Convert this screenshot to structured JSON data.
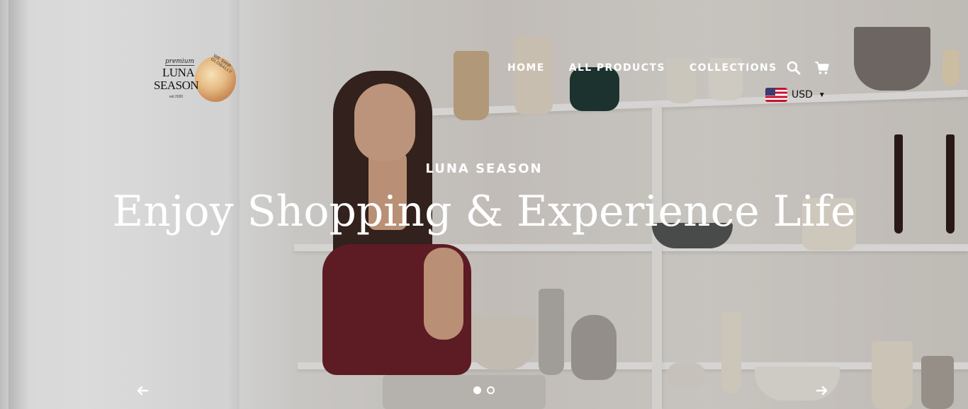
{
  "brand": {
    "logo_top": "premium",
    "logo_line1": "LUNA",
    "logo_line2": "SEASON",
    "logo_est": "est 2020",
    "logo_ribbon": "WE SHIP GLOBALLY"
  },
  "nav": {
    "items": [
      "HOME",
      "ALL PRODUCTS",
      "COLLECTIONS"
    ]
  },
  "icons": {
    "search": "search-icon",
    "cart": "cart-icon",
    "flag": "us-flag-icon",
    "prev": "arrow-left-icon",
    "next": "arrow-right-icon"
  },
  "currency": {
    "selected": "USD"
  },
  "slide": {
    "subheading": "LUNA SEASON",
    "heading": "Enjoy Shopping & Experience Life",
    "count": 2,
    "active_index": 0
  },
  "colors": {
    "overlay_text": "#ffffff",
    "accent_top": "#6a1f2a"
  }
}
